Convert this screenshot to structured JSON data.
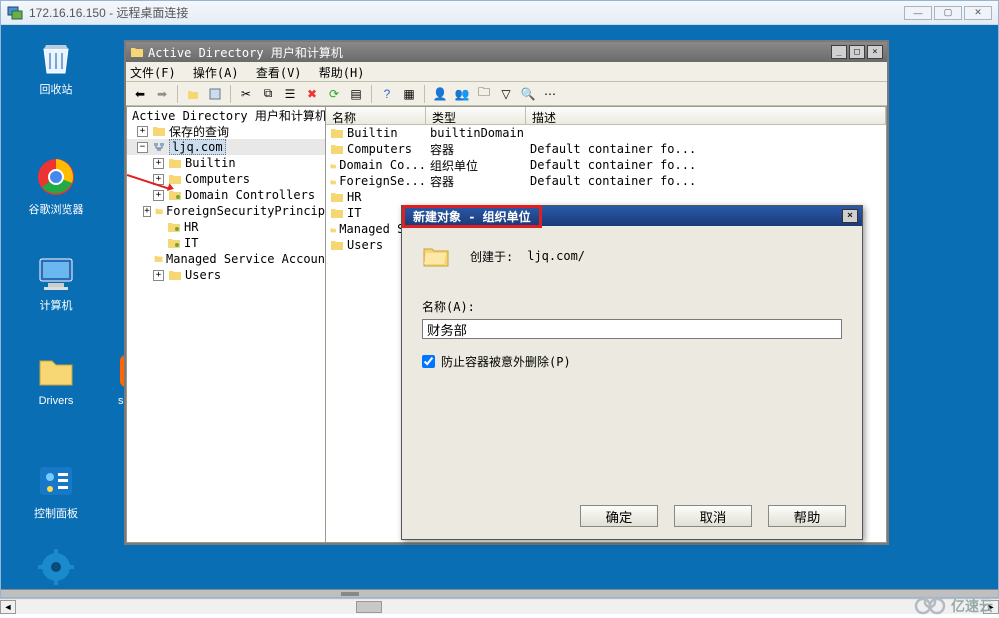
{
  "outerWindow": {
    "title": "172.16.16.150 - 远程桌面连接",
    "min": "—",
    "max": "▢",
    "close": "✕"
  },
  "desktopIcons": {
    "recycle": "回收站",
    "chrome": "谷歌浏览器",
    "computer": "计算机",
    "drivers": "Drivers",
    "sogou": "sogou_",
    "cpanel": "控制面板"
  },
  "mmc": {
    "title": "Active Directory 用户和计算机",
    "menu": {
      "file": "文件(F)",
      "action": "操作(A)",
      "view": "查看(V)",
      "help": "帮助(H)"
    },
    "tree": {
      "root": "Active Directory 用户和计算机",
      "savedQueries": "保存的查询",
      "domain": "ljq.com",
      "nodes": {
        "builtin": "Builtin",
        "computers": "Computers",
        "dc": "Domain Controllers",
        "fsp": "ForeignSecurityPrincip",
        "hr": "HR",
        "it": "IT",
        "msa": "Managed Service Accoun",
        "users": "Users"
      }
    },
    "list": {
      "headers": {
        "name": "名称",
        "type": "类型",
        "desc": "描述"
      },
      "rows": [
        {
          "name": "Builtin",
          "type": "builtinDomain",
          "desc": ""
        },
        {
          "name": "Computers",
          "type": "容器",
          "desc": "Default container fo..."
        },
        {
          "name": "Domain Co...",
          "type": "组织单位",
          "desc": "Default container fo..."
        },
        {
          "name": "ForeignSe...",
          "type": "容器",
          "desc": "Default container fo..."
        },
        {
          "name": "HR",
          "type": "",
          "desc": ""
        },
        {
          "name": "IT",
          "type": "",
          "desc": ""
        },
        {
          "name": "Managed S...",
          "type": "",
          "desc": ""
        },
        {
          "name": "Users",
          "type": "",
          "desc": ""
        }
      ]
    }
  },
  "dialog": {
    "title": "新建对象 - 组织单位",
    "createdInLabel": "创建于:",
    "createdInVal": "ljq.com/",
    "nameLabel": "名称(A):",
    "nameVal": "财务部",
    "checkLabel": "防止容器被意外删除(P)",
    "buttons": {
      "ok": "确定",
      "cancel": "取消",
      "help": "帮助"
    }
  },
  "watermark": "亿速云"
}
